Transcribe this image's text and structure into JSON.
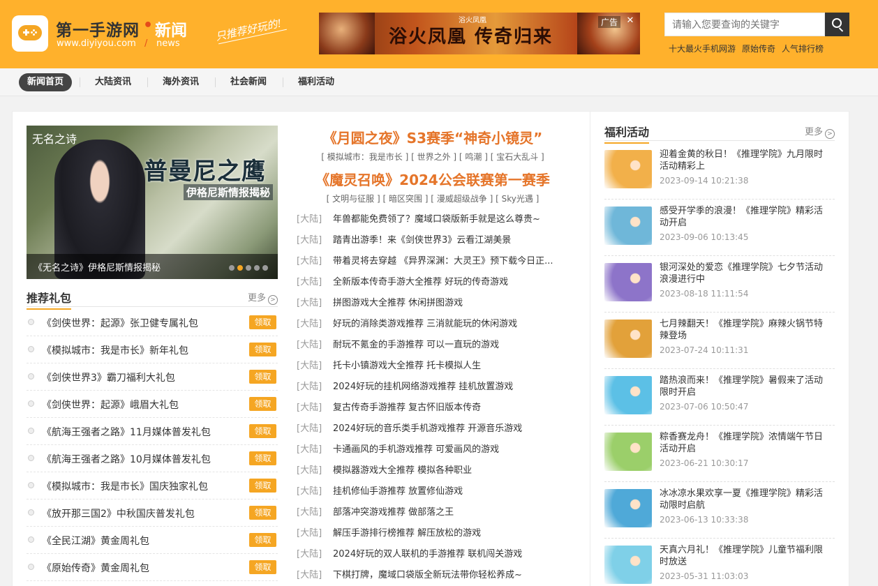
{
  "header": {
    "site_name": "第一手游网",
    "site_dot": "•",
    "section": "新闻",
    "url": "www.diyiyou.com",
    "slash": "/",
    "section_en": "news",
    "slogan": "只推荐好玩的!",
    "ad": {
      "text": "浴火凤凰 传奇归来",
      "brand": "浴火凤凰",
      "label": "广告",
      "close": "✕"
    },
    "search": {
      "placeholder": "请输入您要查询的关键字"
    },
    "hot_links": [
      "十大最火手机网游",
      "原始传奇",
      "人气排行榜"
    ]
  },
  "nav": {
    "items": [
      "新闻首页",
      "大陆资讯",
      "海外资讯",
      "社会新闻",
      "福利活动"
    ],
    "active_index": 0
  },
  "feature": {
    "game_title": "无名之诗",
    "big_title": "普曼尼之鹰",
    "sub_title": "伊格尼斯情报揭秘",
    "caption": "《无名之诗》伊格尼斯情报揭秘",
    "slide_count": 5,
    "active_slide": 1
  },
  "gifts": {
    "title": "推荐礼包",
    "more": "更多",
    "button_label": "领取",
    "items": [
      "《剑侠世界：起源》张卫健专属礼包",
      "《模拟城市：我是市长》新年礼包",
      "《剑侠世界3》霸刀福利大礼包",
      "《剑侠世界：起源》峨眉大礼包",
      "《航海王强者之路》11月媒体普发礼包",
      "《航海王强者之路》10月媒体普发礼包",
      "《模拟城市：我是市长》国庆独家礼包",
      "《放开那三国2》中秋国庆普发礼包",
      "《全民江湖》黄金周礼包",
      "《原始传奇》黄金周礼包"
    ]
  },
  "headlines": [
    {
      "title": "《月圆之夜》S3赛季“神奇小镜灵”",
      "tags": "[ 模拟城市：我是市长 ] [ 世界之外 ] [ 鸣潮 ] [ 宝石大乱斗 ]"
    },
    {
      "title": "《魔灵召唤》2024公会联赛第一赛季",
      "tags": "[ 文明与征服 ] [ 暗区突围 ] [ 漫威超级战争 ] [ Sky光遇 ]"
    }
  ],
  "news": [
    {
      "cat": "[大陆]",
      "title": "年兽都能免费领了？魔域口袋版新手就是这么尊贵~"
    },
    {
      "cat": "[大陆]",
      "title": "踏青出游季！来《剑侠世界3》云看江湖美景"
    },
    {
      "cat": "[大陆]",
      "title": "带着灵将去穿越 《异界深渊：大灵王》预下载今日正..."
    },
    {
      "cat": "[大陆]",
      "title": "全新版本传奇手游大全推荐 好玩的传奇游戏"
    },
    {
      "cat": "[大陆]",
      "title": "拼图游戏大全推荐 休闲拼图游戏"
    },
    {
      "cat": "[大陆]",
      "title": "好玩的消除类游戏推荐 三消就能玩的休闲游戏"
    },
    {
      "cat": "[大陆]",
      "title": "耐玩不氪金的手游推荐 可以一直玩的游戏"
    },
    {
      "cat": "[大陆]",
      "title": "托卡小镇游戏大全推荐 托卡模拟人生"
    },
    {
      "cat": "[大陆]",
      "title": "2024好玩的挂机网络游戏推荐 挂机放置游戏"
    },
    {
      "cat": "[大陆]",
      "title": "复古传奇手游推荐 复古怀旧版本传奇"
    },
    {
      "cat": "[大陆]",
      "title": "2024好玩的音乐类手机游戏推荐 开源音乐游戏"
    },
    {
      "cat": "[大陆]",
      "title": "卡通画风的手机游戏推荐 可爱画风的游戏"
    },
    {
      "cat": "[大陆]",
      "title": "模拟器游戏大全推荐 模拟各种职业"
    },
    {
      "cat": "[大陆]",
      "title": "挂机修仙手游推荐 放置修仙游戏"
    },
    {
      "cat": "[大陆]",
      "title": "部落冲突游戏推荐 做部落之王"
    },
    {
      "cat": "[大陆]",
      "title": "解压手游排行榜推荐 解压放松的游戏"
    },
    {
      "cat": "[大陆]",
      "title": "2024好玩的双人联机的手游推荐 联机闯关游戏"
    },
    {
      "cat": "[大陆]",
      "title": "下棋打牌，魔域口袋版全新玩法带你轻松养成~"
    }
  ],
  "promo": {
    "title": "福利活动",
    "more": "更多",
    "items": [
      {
        "title": "迎着金黄的秋日！《推理学院》九月限时活动精彩上",
        "time": "2023-09-14 10:21:38",
        "color": "#f2b04a"
      },
      {
        "title": "感受开学季的浪漫！《推理学院》精彩活动开启",
        "time": "2023-09-06 10:13:45",
        "color": "#6fb7d9"
      },
      {
        "title": "银河深处的爱恋《推理学院》七夕节活动浪漫进行中",
        "time": "2023-08-18 11:11:54",
        "color": "#8d74c9"
      },
      {
        "title": "七月辣翻天！《推理学院》麻辣火锅节特辣登场",
        "time": "2023-07-24 10:11:31",
        "color": "#e2a13a"
      },
      {
        "title": "踏热浪而来！《推理学院》暑假来了活动限时开启",
        "time": "2023-07-06 10:50:47",
        "color": "#5cc0e6"
      },
      {
        "title": "粽香赛龙舟！《推理学院》浓情端午节日活动开启",
        "time": "2023-06-21 10:30:17",
        "color": "#9bcf6a"
      },
      {
        "title": "冰冰凉水果欢享一夏《推理学院》精彩活动限时启航",
        "time": "2023-06-13 10:33:38",
        "color": "#4fa9d8"
      },
      {
        "title": "天真六月礼！《推理学院》儿童节福利限时放送",
        "time": "2023-05-31 11:03:03",
        "color": "#7fd0e8"
      }
    ]
  }
}
